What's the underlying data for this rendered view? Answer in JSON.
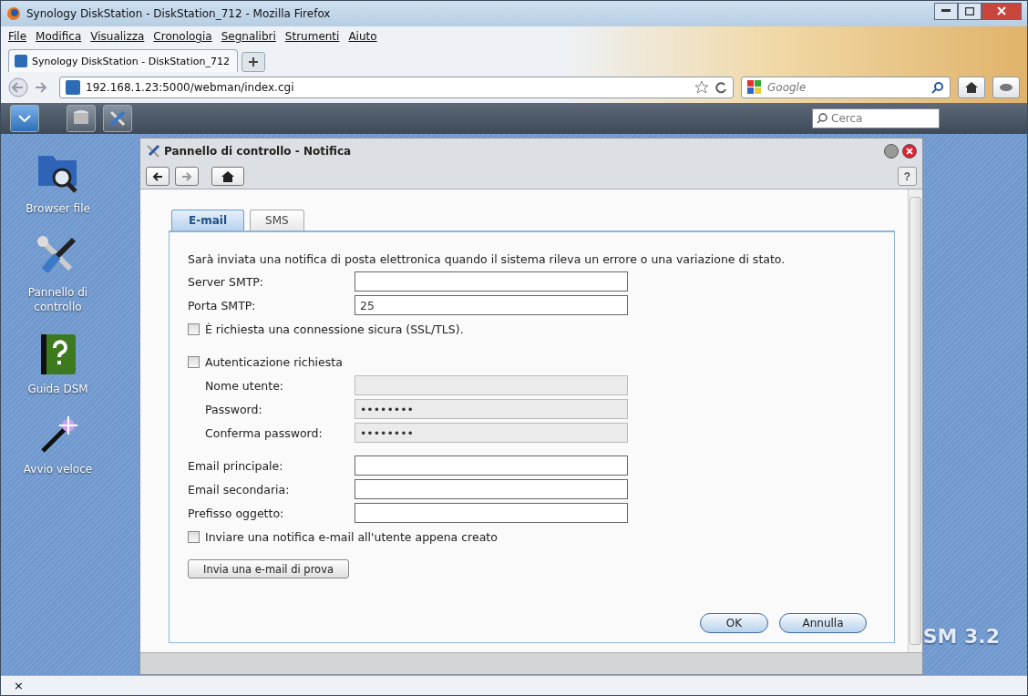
{
  "browser": {
    "title": "Synology DiskStation - DiskStation_712 - Mozilla Firefox",
    "menu": [
      "File",
      "Modifica",
      "Visualizza",
      "Cronologia",
      "Segnalibri",
      "Strumenti",
      "Aiuto"
    ],
    "tabs": [
      {
        "label": "Synology DiskStation - DiskStation_712",
        "selected": true
      }
    ],
    "address": "192.168.1.23:5000/webman/index.cgi",
    "search_placeholder": "Google",
    "status_close": "×"
  },
  "dsm_taskbar": {
    "search_placeholder": "Cerca"
  },
  "desktop_icons": [
    {
      "kind": "folder",
      "label": "Browser file"
    },
    {
      "kind": "tools",
      "label": "Pannello di controllo"
    },
    {
      "kind": "help",
      "label": "Guida DSM"
    },
    {
      "kind": "wand",
      "label": "Avvio veloce"
    }
  ],
  "desktop_brand": "SM 3.2",
  "dialog": {
    "title": "Pannello di controllo - Notifica",
    "help": "?",
    "tabs": [
      {
        "label": "E-mail",
        "selected": true
      },
      {
        "label": "SMS",
        "selected": false
      }
    ],
    "description": "Sarà inviata una notifica di posta elettronica quando il sistema rileva un errore o una variazione di stato.",
    "groups": [
      [
        {
          "kind": "field",
          "label": "Server SMTP:",
          "disabled": false,
          "indented": false
        },
        {
          "kind": "field",
          "label": "Porta SMTP:",
          "value": "25",
          "disabled": false,
          "indented": false
        },
        {
          "kind": "checkbox",
          "label": "È richiesta una connessione sicura (SSL/TLS).",
          "checked": false
        }
      ],
      [
        {
          "kind": "checkbox",
          "label": "Autenticazione richiesta",
          "checked": false
        },
        {
          "kind": "field",
          "label": "Nome utente:",
          "disabled": true,
          "indented": true
        },
        {
          "kind": "password",
          "label": "Password:",
          "value": "••••••••",
          "disabled": true,
          "indented": true
        },
        {
          "kind": "password",
          "label": "Conferma password:",
          "value": "••••••••",
          "disabled": true,
          "indented": true
        }
      ],
      [
        {
          "kind": "field",
          "label": "Email principale:",
          "disabled": false,
          "indented": false
        },
        {
          "kind": "field",
          "label": "Email secondaria:",
          "disabled": false,
          "indented": false
        },
        {
          "kind": "field",
          "label": "Prefisso oggetto:",
          "disabled": false,
          "indented": false
        },
        {
          "kind": "checkbox",
          "label": "Inviare una notifica e-mail all'utente appena creato",
          "checked": false
        }
      ]
    ],
    "test_button": "Invia una e-mail di prova",
    "buttons": [
      "OK",
      "Annulla"
    ]
  }
}
